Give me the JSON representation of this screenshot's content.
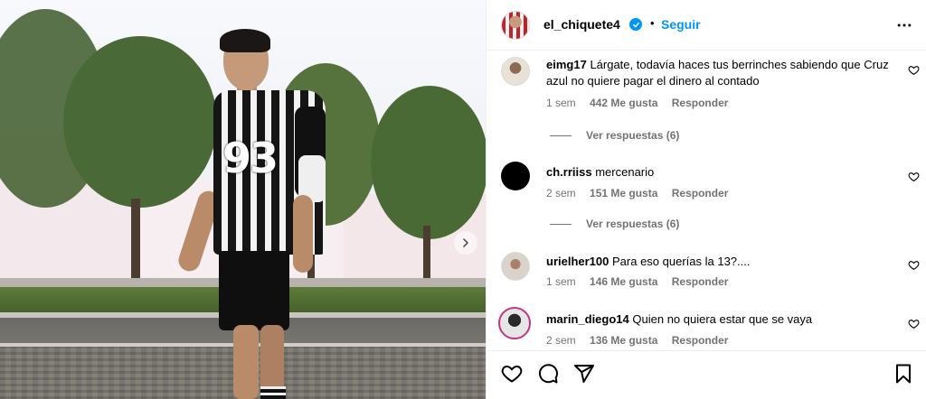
{
  "post": {
    "jersey_number": "93",
    "next_icon": "chevron-right-icon"
  },
  "header": {
    "username": "el_chiquete4",
    "separator": "•",
    "follow_label": "Seguir",
    "more_icon": "more-horizontal-icon"
  },
  "comments": [
    {
      "username": "eimg17",
      "text": "Lárgate, todavía haces tus berrinches sabiendo que Cruz azul no quiere pagar el dinero al contado",
      "time": "1 sem",
      "likes": "442 Me gusta",
      "reply": "Responder",
      "view_replies": "Ver respuestas (6)"
    },
    {
      "username": "ch.rriiss",
      "text": "mercenario",
      "time": "2 sem",
      "likes": "151 Me gusta",
      "reply": "Responder",
      "view_replies": "Ver respuestas (6)"
    },
    {
      "username": "urielher100",
      "text": "Para eso querías la 13?....",
      "time": "1 sem",
      "likes": "146 Me gusta",
      "reply": "Responder"
    },
    {
      "username": "marin_diego14",
      "text": "Quien no quiera estar que se vaya",
      "time": "2 sem",
      "likes": "136 Me gusta",
      "reply": "Responder"
    }
  ],
  "actions": {
    "like_icon": "heart-icon",
    "comment_icon": "comment-icon",
    "share_icon": "share-icon",
    "save_icon": "bookmark-icon"
  },
  "colors": {
    "accent": "#0095f6",
    "meta_text": "#737373",
    "border": "#efefef"
  }
}
